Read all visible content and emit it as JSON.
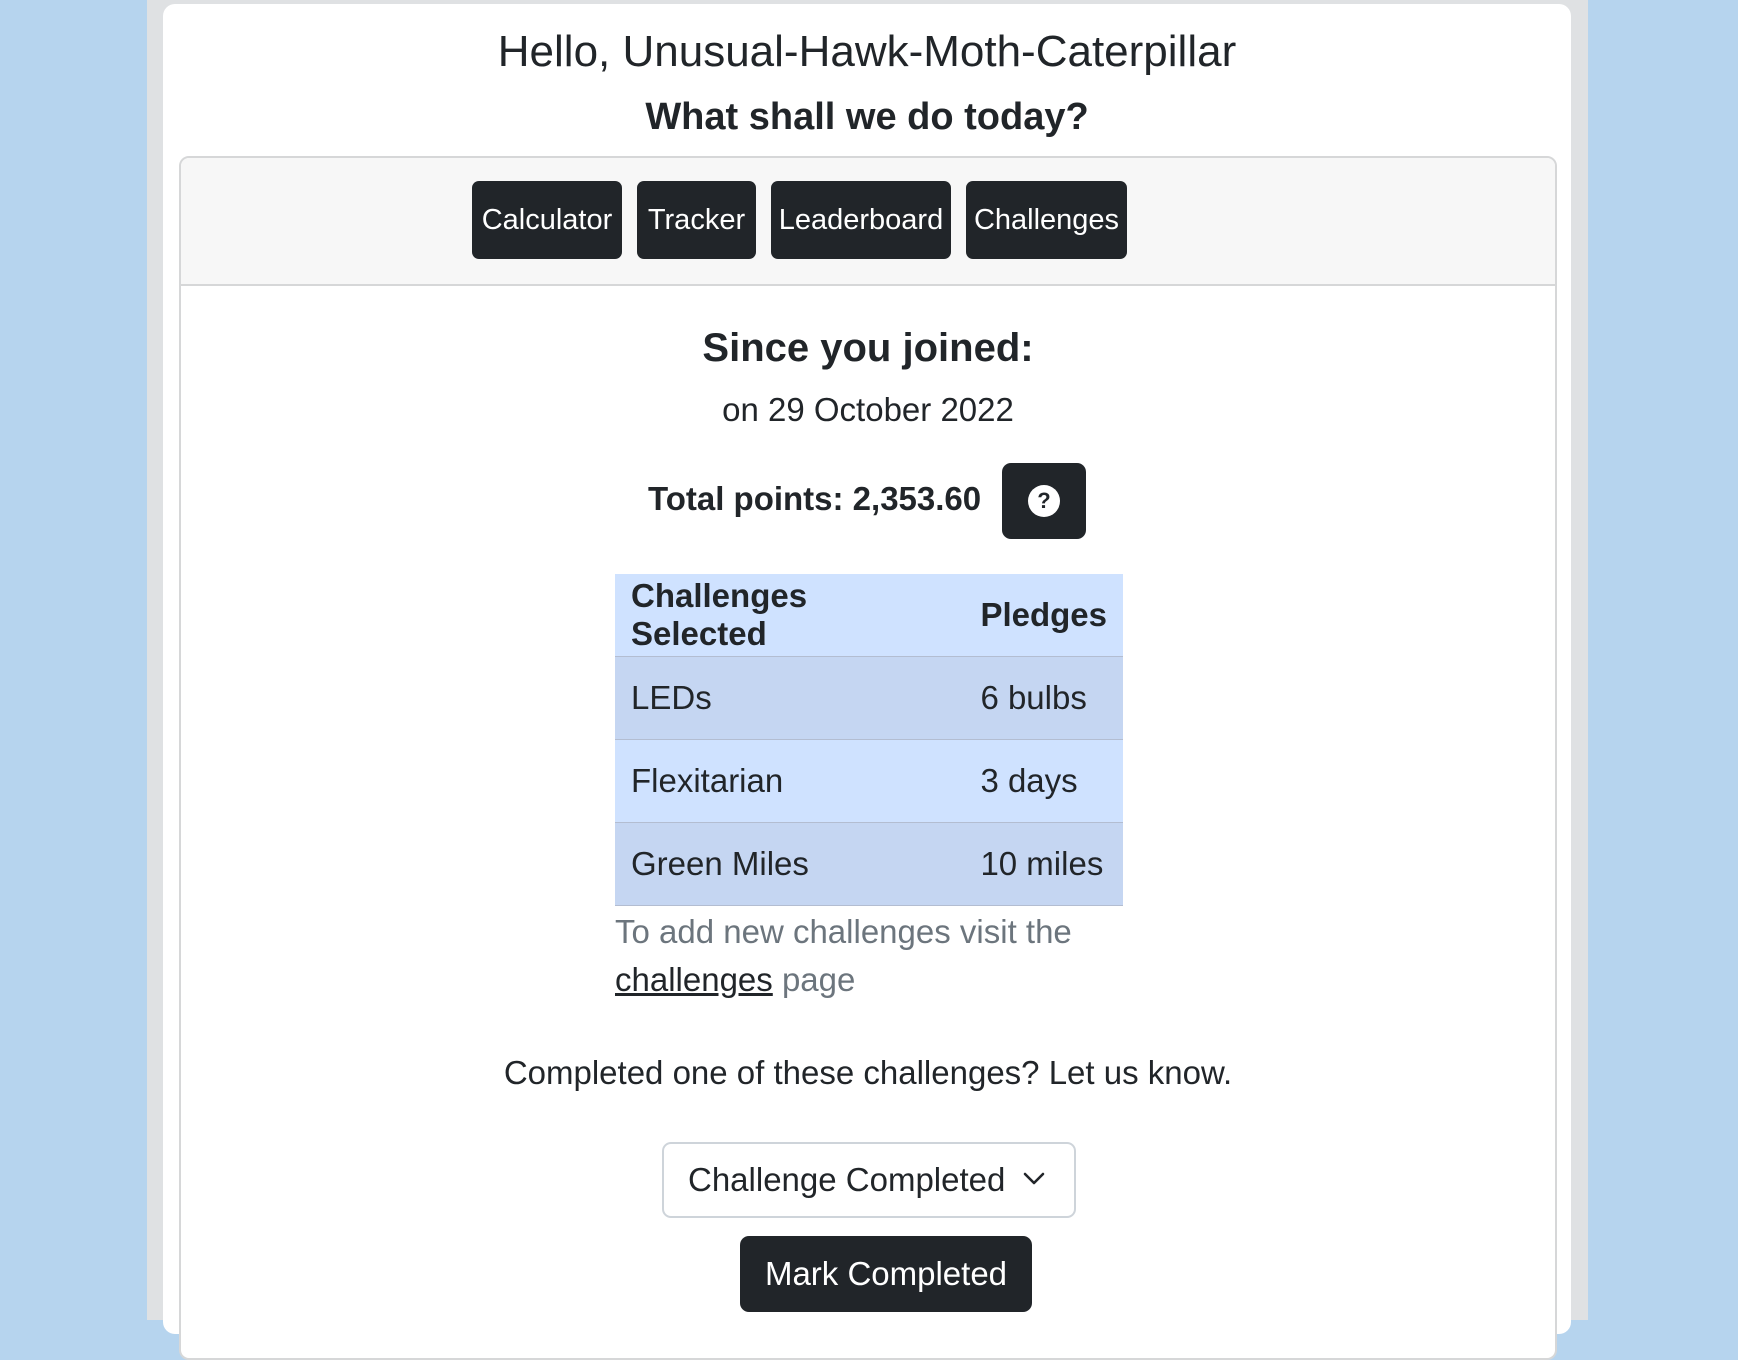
{
  "header": {
    "greeting": "Hello, Unusual-Hawk-Moth-Caterpillar",
    "subtitle": "What shall we do today?"
  },
  "nav": {
    "calculator": "Calculator",
    "tracker": "Tracker",
    "leaderboard": "Leaderboard",
    "challenges": "Challenges"
  },
  "summary": {
    "title": "Since you joined:",
    "joined_date": "on 29 October 2022",
    "total_points": "Total points: 2,353.60",
    "help_icon": "question-circle-icon"
  },
  "table": {
    "headers": [
      "Challenges Selected",
      "Pledges"
    ],
    "rows": [
      {
        "challenge": "LEDs",
        "pledge": "6 bulbs"
      },
      {
        "challenge": "Flexitarian",
        "pledge": "3 days"
      },
      {
        "challenge": "Green Miles",
        "pledge": "10 miles"
      }
    ]
  },
  "helper": {
    "prefix": "To add new challenges visit the",
    "link": "challenges",
    "suffix": "page"
  },
  "completion": {
    "question": "Completed one of these challenges? Let us know.",
    "select_value": "Challenge Completed",
    "button": "Mark Completed"
  },
  "colors": {
    "background": "#b6d4ee",
    "button_dark": "#212529",
    "table_header": "#cfe2ff",
    "table_row_alt": "#c5d6f2",
    "muted_text": "#6c757d"
  }
}
